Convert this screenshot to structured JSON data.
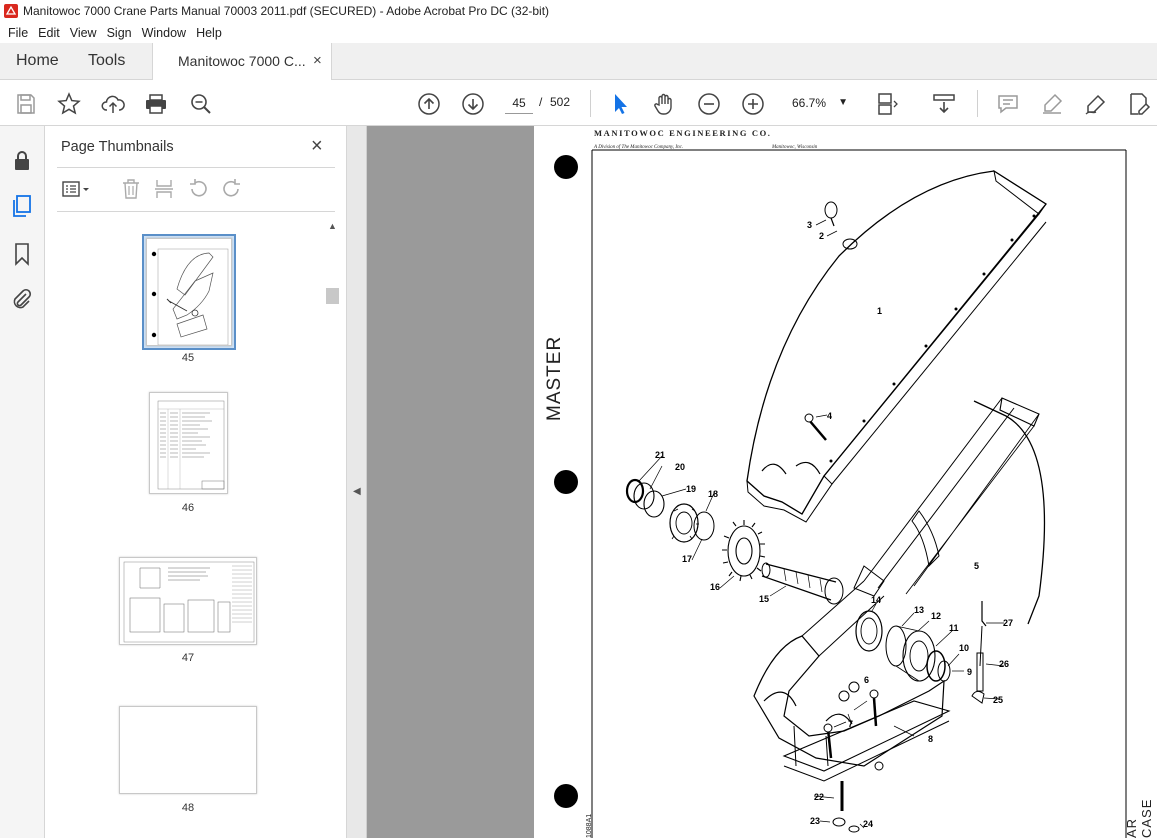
{
  "window": {
    "title": "Manitowoc 7000 Crane Parts Manual 70003 2011.pdf (SECURED) - Adobe Acrobat Pro DC (32-bit)"
  },
  "menu": [
    "File",
    "Edit",
    "View",
    "Sign",
    "Window",
    "Help"
  ],
  "tabs": {
    "home": "Home",
    "tools": "Tools",
    "document": "Manitowoc 7000 C...",
    "close": "×"
  },
  "toolbar": {
    "current_page": "45",
    "separator": "/",
    "total_pages": "502",
    "zoom": "66.7%",
    "icons": [
      "save-icon",
      "bookmark-star-icon",
      "upload-icon",
      "print-icon",
      "search-zoom-icon",
      "page-up-icon",
      "page-down-icon",
      "select-arrow-icon",
      "hand-icon",
      "zoom-out-icon",
      "zoom-in-icon",
      "fit-page-icon",
      "scroll-mode-icon",
      "comment-icon",
      "highlight-icon",
      "sign-icon",
      "edit-pdf-icon"
    ]
  },
  "thumbnails_panel": {
    "title": "Page Thumbnails",
    "close": "×",
    "pages": [
      {
        "number": "45",
        "selected": true
      },
      {
        "number": "46",
        "selected": false
      },
      {
        "number": "47",
        "selected": false
      },
      {
        "number": "48",
        "selected": false
      }
    ]
  },
  "document": {
    "header": "MANITOWOC ENGINEERING CO.",
    "subheader_left": "A Division of The Manitowoc Company, Inc.",
    "subheader_right": "Manitowoc, Wisconsin",
    "watermark": "MASTER",
    "side_title": "AR CASE",
    "footer_code": "1088A1",
    "part_labels": [
      "1",
      "2",
      "3",
      "4",
      "5",
      "6",
      "7",
      "8",
      "9",
      "10",
      "11",
      "12",
      "13",
      "14",
      "15",
      "16",
      "17",
      "18",
      "19",
      "20",
      "21",
      "22",
      "23",
      "24",
      "25",
      "26",
      "27"
    ]
  },
  "colors": {
    "accent": "#1473e6",
    "selected_thumb": "#5a8fc8",
    "doc_bg": "#9a9a9a"
  }
}
